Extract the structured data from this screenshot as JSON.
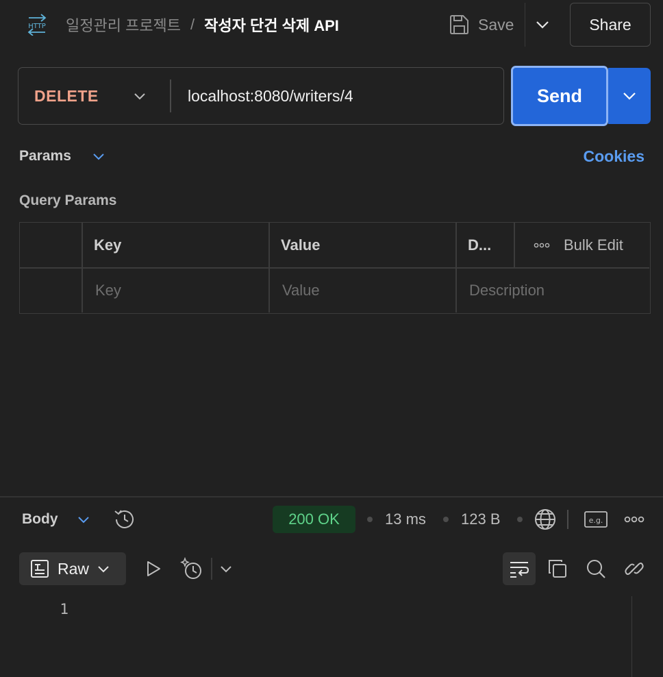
{
  "header": {
    "protocol_icon": "http-icon",
    "collection": "일정관리 프로젝트",
    "separator": "/",
    "request_name": "작성자 단건 삭제 API",
    "save_label": "Save",
    "share_label": "Share"
  },
  "request": {
    "method": "DELETE",
    "url": "localhost:8080/writers/4",
    "send_label": "Send"
  },
  "params": {
    "tab_label": "Params",
    "cookies_label": "Cookies",
    "section_title": "Query Params",
    "columns": {
      "key": "Key",
      "value": "Value",
      "description": "D..."
    },
    "bulk_edit_label": "Bulk Edit",
    "placeholder_row": {
      "key": "Key",
      "value": "Value",
      "description": "Description"
    }
  },
  "response": {
    "tab_label": "Body",
    "status": "200 OK",
    "time": "13 ms",
    "size": "123 B",
    "format": "Raw",
    "line_numbers": [
      "1"
    ]
  },
  "colors": {
    "background": "#212121",
    "accent_blue": "#2366d9",
    "link_blue": "#5a9cf0",
    "method_delete": "#f0a28a",
    "status_ok_text": "#5fd38a",
    "status_ok_bg": "#163b22"
  }
}
